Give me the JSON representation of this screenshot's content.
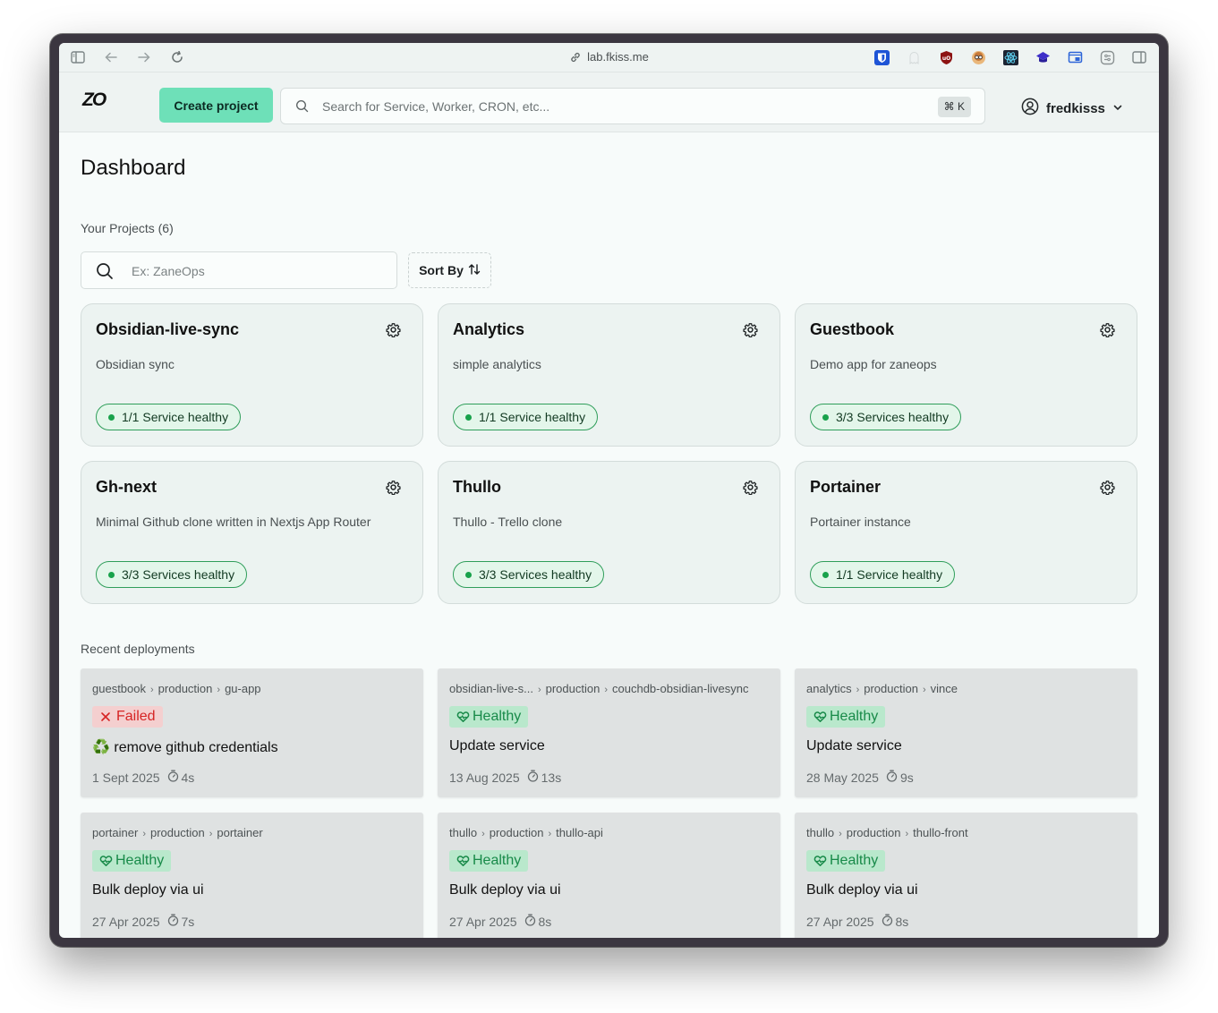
{
  "browser": {
    "url": "lab.fkiss.me",
    "extensions": [
      {
        "name": "bitwarden-ext-icon",
        "color": "#1e54d6"
      },
      {
        "name": "ghost-ext-icon",
        "color": "#e8ecec"
      },
      {
        "name": "ublock-ext-icon",
        "color": "#8d1313"
      },
      {
        "name": "avatar-ext-icon",
        "color": "#d27d3a"
      },
      {
        "name": "react-devtools-ext-icon",
        "color": "#1b2433"
      },
      {
        "name": "graduation-ext-icon",
        "color": "#3e2fc9"
      },
      {
        "name": "window-ext-icon",
        "color": "#2c64d8"
      },
      {
        "name": "settings-ext-icon",
        "color": "#8a9192"
      }
    ]
  },
  "header": {
    "logo": "ZO",
    "create_label": "Create project",
    "search_placeholder": "Search for Service, Worker, CRON, etc...",
    "shortcut": "⌘ K",
    "username": "fredkisss"
  },
  "main": {
    "title": "Dashboard",
    "projects_label": "Your Projects (6)",
    "project_search_placeholder": "Ex: ZaneOps",
    "sort_label": "Sort By",
    "recent_label": "Recent deployments"
  },
  "projects": [
    {
      "name": "Obsidian-live-sync",
      "description": "Obsidian sync",
      "status": "1/1 Service healthy"
    },
    {
      "name": "Analytics",
      "description": "simple analytics",
      "status": "1/1 Service healthy"
    },
    {
      "name": "Guestbook",
      "description": "Demo app for zaneops",
      "status": "3/3 Services healthy"
    },
    {
      "name": "Gh-next",
      "description": "Minimal Github clone written in Nextjs App Router",
      "status": "3/3 Services healthy"
    },
    {
      "name": "Thullo",
      "description": "Thullo - Trello clone",
      "status": "3/3 Services healthy"
    },
    {
      "name": "Portainer",
      "description": "Portainer instance",
      "status": "1/1 Service healthy"
    }
  ],
  "deployments": [
    {
      "crumbs": [
        "guestbook",
        "production",
        "gu-app"
      ],
      "status": "Failed",
      "status_type": "failed",
      "message": "♻️ remove github credentials",
      "date": "1 Sept 2025",
      "duration": "4s"
    },
    {
      "crumbs": [
        "obsidian-live-s...",
        "production",
        "couchdb-obsidian-livesync"
      ],
      "status": "Healthy",
      "status_type": "healthy",
      "message": "Update service",
      "date": "13 Aug 2025",
      "duration": "13s"
    },
    {
      "crumbs": [
        "analytics",
        "production",
        "vince"
      ],
      "status": "Healthy",
      "status_type": "healthy",
      "message": "Update service",
      "date": "28 May 2025",
      "duration": "9s"
    },
    {
      "crumbs": [
        "portainer",
        "production",
        "portainer"
      ],
      "status": "Healthy",
      "status_type": "healthy",
      "message": "Bulk deploy via ui",
      "date": "27 Apr 2025",
      "duration": "7s"
    },
    {
      "crumbs": [
        "thullo",
        "production",
        "thullo-api"
      ],
      "status": "Healthy",
      "status_type": "healthy",
      "message": "Bulk deploy via ui",
      "date": "27 Apr 2025",
      "duration": "8s"
    },
    {
      "crumbs": [
        "thullo",
        "production",
        "thullo-front"
      ],
      "status": "Healthy",
      "status_type": "healthy",
      "message": "Bulk deploy via ui",
      "date": "27 Apr 2025",
      "duration": "8s"
    }
  ],
  "colors": {
    "accent": "#6ee0b8",
    "healthy": "#188a49",
    "failed": "#d62424"
  }
}
